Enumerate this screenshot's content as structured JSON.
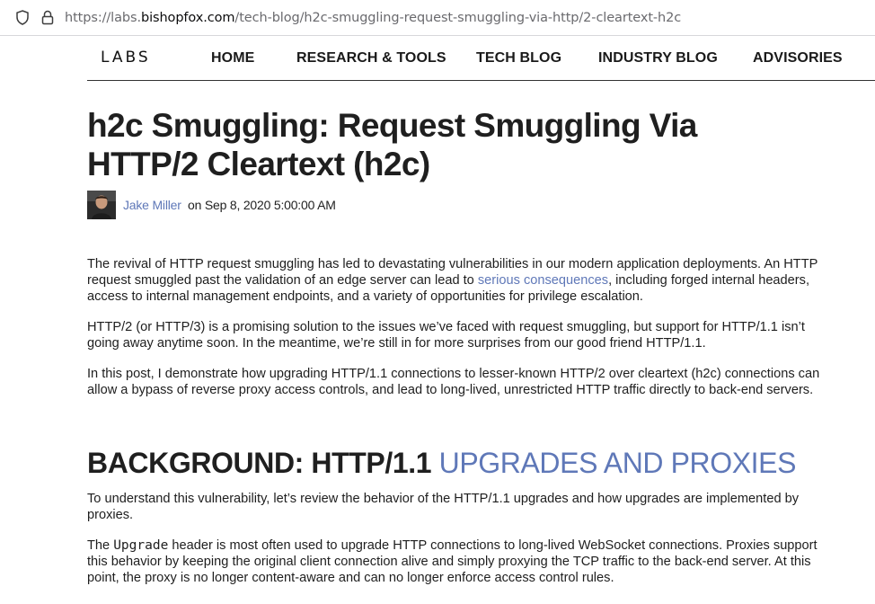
{
  "browser": {
    "url_prefix": "https://labs.",
    "url_host": "bishopfox.com",
    "url_path": "/tech-blog/h2c-smuggling-request-smuggling-via-http/2-cleartext-h2c"
  },
  "nav": {
    "logo": "LABS",
    "items": [
      "HOME",
      "RESEARCH & TOOLS",
      "TECH BLOG",
      "INDUSTRY BLOG",
      "ADVISORIES"
    ]
  },
  "article": {
    "title": "h2c Smuggling: Request Smuggling Via HTTP/2 Cleartext (h2c)",
    "author": "Jake Miller",
    "date": "on Sep 8, 2020 5:00:00 AM",
    "p1_before": "The revival of HTTP request smuggling has led to devastating vulnerabilities in our modern application deployments. An HTTP request smuggled past the validation of an edge server can lead to ",
    "p1_link": "serious consequences",
    "p1_after": ", including forged internal headers, access to internal management endpoints, and a variety of opportunities for privilege escalation.",
    "p2": "HTTP/2 (or HTTP/3) is a promising solution to the issues we’ve faced with request smuggling, but support for HTTP/1.1 isn’t going away anytime soon. In the meantime, we’re still in for more surprises from our good friend HTTP/1.1.",
    "p3": "In this post, I demonstrate how upgrading HTTP/1.1 connections to lesser-known HTTP/2 over cleartext (h2c) connections can allow a bypass of reverse proxy access controls, and lead to long-lived, unrestricted HTTP traffic directly to back-end servers.",
    "h2_dark": "BACKGROUND: HTTP/1.1 ",
    "h2_accent": "UPGRADES AND PROXIES",
    "p4": "To understand this vulnerability, let’s review the behavior of the HTTP/1.1 upgrades and how upgrades are implemented by proxies.",
    "p5_before": "The ",
    "p5_code": "Upgrade",
    "p5_after": " header is most often used to upgrade HTTP connections to long-lived WebSocket connections. Proxies support this behavior by keeping the original client connection alive and simply proxying the TCP traffic to the back-end server. At this point, the proxy is no longer content-aware and can no longer enforce access control rules."
  },
  "colors": {
    "link": "#5f78b8",
    "text": "#1e1e1e"
  },
  "icons": [
    "tracking-shield-icon",
    "lock-icon"
  ]
}
